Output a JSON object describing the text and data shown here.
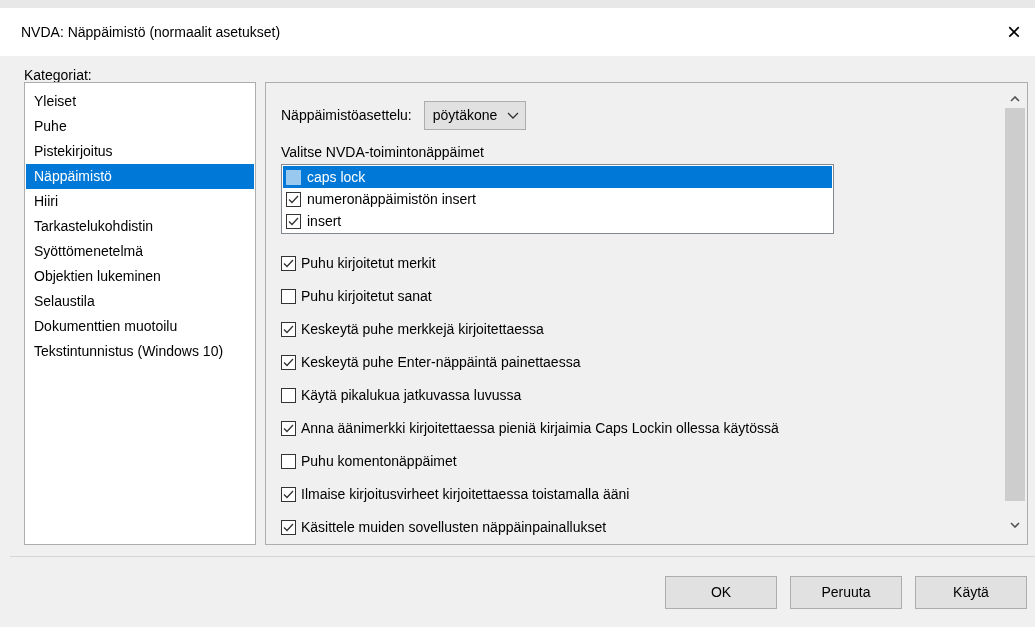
{
  "window": {
    "title": "NVDA: Näppäimistö (normaalit asetukset)",
    "close": "×"
  },
  "categories": {
    "label": "Kategoriat:",
    "items": [
      {
        "label": "Yleiset",
        "selected": false
      },
      {
        "label": "Puhe",
        "selected": false
      },
      {
        "label": "Pistekirjoitus",
        "selected": false
      },
      {
        "label": "Näppäimistö",
        "selected": true
      },
      {
        "label": "Hiiri",
        "selected": false
      },
      {
        "label": "Tarkastelukohdistin",
        "selected": false
      },
      {
        "label": "Syöttömenetelmä",
        "selected": false
      },
      {
        "label": "Objektien lukeminen",
        "selected": false
      },
      {
        "label": "Selaustila",
        "selected": false
      },
      {
        "label": "Dokumenttien muotoilu",
        "selected": false
      },
      {
        "label": "Tekstintunnistus (Windows 10)",
        "selected": false
      }
    ]
  },
  "layout": {
    "label": "Näppäimistöasettelu:",
    "value": "pöytäkone"
  },
  "modifier_keys": {
    "label": "Valitse NVDA-toimintonäppäimet",
    "items": [
      {
        "label": "caps lock",
        "checked": false,
        "selected": true
      },
      {
        "label": "numeronäppäimistön insert",
        "checked": true,
        "selected": false
      },
      {
        "label": "insert",
        "checked": true,
        "selected": false
      }
    ]
  },
  "options": [
    {
      "label": "Puhu kirjoitetut merkit",
      "checked": true
    },
    {
      "label": "Puhu kirjoitetut sanat",
      "checked": false
    },
    {
      "label": "Keskeytä puhe merkkejä kirjoitettaessa",
      "checked": true
    },
    {
      "label": "Keskeytä puhe Enter-näppäintä painettaessa",
      "checked": true
    },
    {
      "label": "Käytä pikalukua jatkuvassa luvussa",
      "checked": false
    },
    {
      "label": "Anna äänimerkki kirjoitettaessa pieniä kirjaimia Caps Lockin ollessa käytössä",
      "checked": true
    },
    {
      "label": "Puhu komentonäppäimet",
      "checked": false
    },
    {
      "label": "Ilmaise kirjoitusvirheet kirjoitettaessa toistamalla ääni",
      "checked": true
    },
    {
      "label": "Käsittele muiden sovellusten näppäinpainallukset",
      "checked": true
    }
  ],
  "buttons": [
    "OK",
    "Peruuta",
    "Käytä"
  ]
}
